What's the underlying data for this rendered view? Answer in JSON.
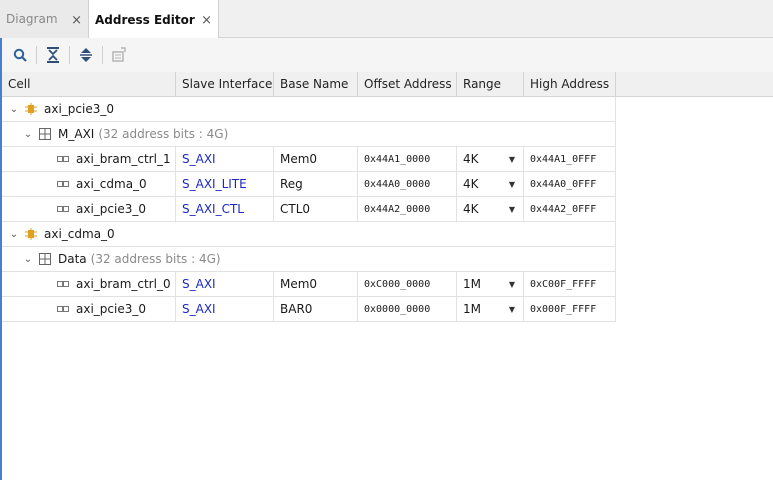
{
  "tabs": [
    {
      "label": "Diagram",
      "close": "×"
    },
    {
      "label": "Address Editor",
      "close": "×"
    }
  ],
  "toolbar": {
    "icons": [
      "search-icon",
      "collapse-all-icon",
      "expand-all-icon",
      "auto-assign-icon"
    ]
  },
  "columns": [
    "Cell",
    "Slave Interface",
    "Base Name",
    "Offset Address",
    "Range",
    "High Address"
  ],
  "tree": {
    "master1": {
      "name": "axi_pcie3_0",
      "space": {
        "name": "M_AXI",
        "note": "(32 address bits : 4G)"
      },
      "rows": [
        {
          "cell": "axi_bram_ctrl_1",
          "slave": "S_AXI",
          "base": "Mem0",
          "offset": "0x44A1_0000",
          "range": "4K",
          "high": "0x44A1_0FFF"
        },
        {
          "cell": "axi_cdma_0",
          "slave": "S_AXI_LITE",
          "base": "Reg",
          "offset": "0x44A0_0000",
          "range": "4K",
          "high": "0x44A0_0FFF"
        },
        {
          "cell": "axi_pcie3_0",
          "slave": "S_AXI_CTL",
          "base": "CTL0",
          "offset": "0x44A2_0000",
          "range": "4K",
          "high": "0x44A2_0FFF"
        }
      ]
    },
    "master2": {
      "name": "axi_cdma_0",
      "space": {
        "name": "Data",
        "note": "(32 address bits : 4G)"
      },
      "rows": [
        {
          "cell": "axi_bram_ctrl_0",
          "slave": "S_AXI",
          "base": "Mem0",
          "offset": "0xC000_0000",
          "range": "1M",
          "high": "0xC00F_FFFF"
        },
        {
          "cell": "axi_pcie3_0",
          "slave": "S_AXI",
          "base": "BAR0",
          "offset": "0x0000_0000",
          "range": "1M",
          "high": "0x000F_FFFF"
        }
      ]
    }
  },
  "colors": {
    "accent": "#4a7fd0",
    "link": "#1b28c7",
    "ip_icon": "#e0a020"
  }
}
